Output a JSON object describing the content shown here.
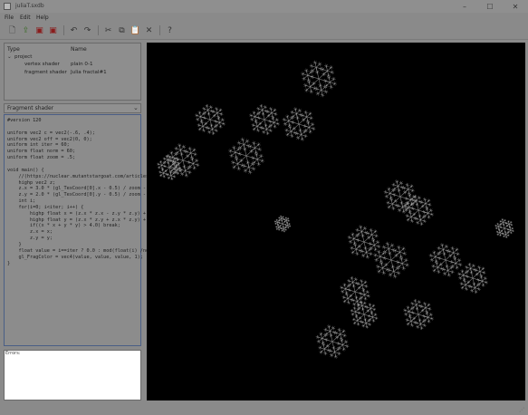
{
  "window": {
    "title": "juliaT.sxdb"
  },
  "menu": [
    {
      "label": "File"
    },
    {
      "label": "Edit"
    },
    {
      "label": "Help"
    }
  ],
  "toolbar_icons": [
    "new-icon",
    "open-icon",
    "save-icon",
    "save-as-icon",
    "undo-icon",
    "redo-icon",
    "cut-icon",
    "copy-icon",
    "paste-icon",
    "delete-icon",
    "help-icon"
  ],
  "tree": {
    "col_type": "Type",
    "col_name": "Name",
    "root": "project",
    "items": [
      {
        "type": "vertex shader",
        "name": "plain 0-1"
      },
      {
        "type": "fragment shader",
        "name": "Julia fractal#1"
      }
    ]
  },
  "editor": {
    "selected_shader": "Fragment shader",
    "code_lines": [
      "#version 120",
      "",
      "uniform vec2 c = vec2(-.6, .4);",
      "uniform vec2 off = vec2(0, 0);",
      "uniform int iter = 60;",
      "uniform float norm = 60;",
      "uniform float zoom = .5;",
      "",
      "void main() {",
      "    //(https://nuclear.mutantstargoat.com/articles/sdr_fract/",
      "    highp vec2 z;",
      "    z.x = 3.0 * (gl_TexCoord[0].x - 0.5) / zoom - off.x;",
      "    z.y = 2.0 * (gl_TexCoord[0].y - 0.5) / zoom - off.y;",
      "    int i;",
      "    for(i=0; i<iter; i++) {",
      "        highp float x = (z.x * z.x - z.y * z.y) + c.x;",
      "        highp float y = (z.x * z.y + z.x * z.y) + c.y;",
      "        if((x * x + y * y) > 4.0) break;",
      "        z.x = x;",
      "        z.y = y;",
      "    }",
      "    float value = i==iter ? 0.0 : mod(float(i) /norm, 1.);",
      "    gl_FragColor = vec4(value, value, value, 1);",
      "}"
    ]
  },
  "log": {
    "label": "Errors:"
  },
  "colors": {
    "view_bg": "#000000",
    "editor_border": "#4a5e86",
    "log_bg": "#ffffff"
  }
}
